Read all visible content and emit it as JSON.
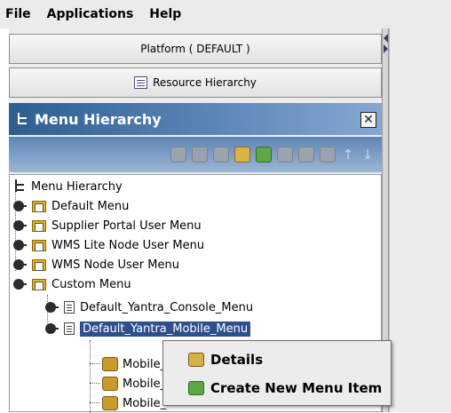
{
  "menubar": {
    "items": [
      {
        "label": "File"
      },
      {
        "label": "Applications"
      },
      {
        "label": "Help"
      }
    ]
  },
  "platform_button": {
    "label": "Platform ( DEFAULT )"
  },
  "resource_button": {
    "label": "Resource Hierarchy",
    "icon": "hierarchy-icon"
  },
  "menu_hierarchy_panel": {
    "title": "Menu Hierarchy",
    "close_icon": "close-icon"
  },
  "toolbar": {
    "icons": [
      "add-icon",
      "copy-icon",
      "delete-icon",
      "details-icon",
      "create-icon",
      "save-icon",
      "open-icon",
      "remove-icon",
      "move-up-icon",
      "move-down-icon"
    ],
    "up_arrow": "↑",
    "down_arrow": "↓"
  },
  "tree": {
    "root": "Menu Hierarchy",
    "nodes": [
      {
        "label": "Default Menu"
      },
      {
        "label": "Supplier Portal User Menu"
      },
      {
        "label": "WMS Lite Node User Menu"
      },
      {
        "label": "WMS Node User Menu"
      },
      {
        "label": "Custom Menu"
      }
    ],
    "children": [
      {
        "label": "Default_Yantra_Console_Menu"
      },
      {
        "label": "Default_Yantra_Mobile_Menu"
      }
    ],
    "leaves": [
      {
        "label": "Mobile_"
      },
      {
        "label": "Mobile_"
      },
      {
        "label": "Mobile_"
      }
    ]
  },
  "context_menu": {
    "details_label": "Details",
    "create_label": "Create New Menu Item"
  }
}
